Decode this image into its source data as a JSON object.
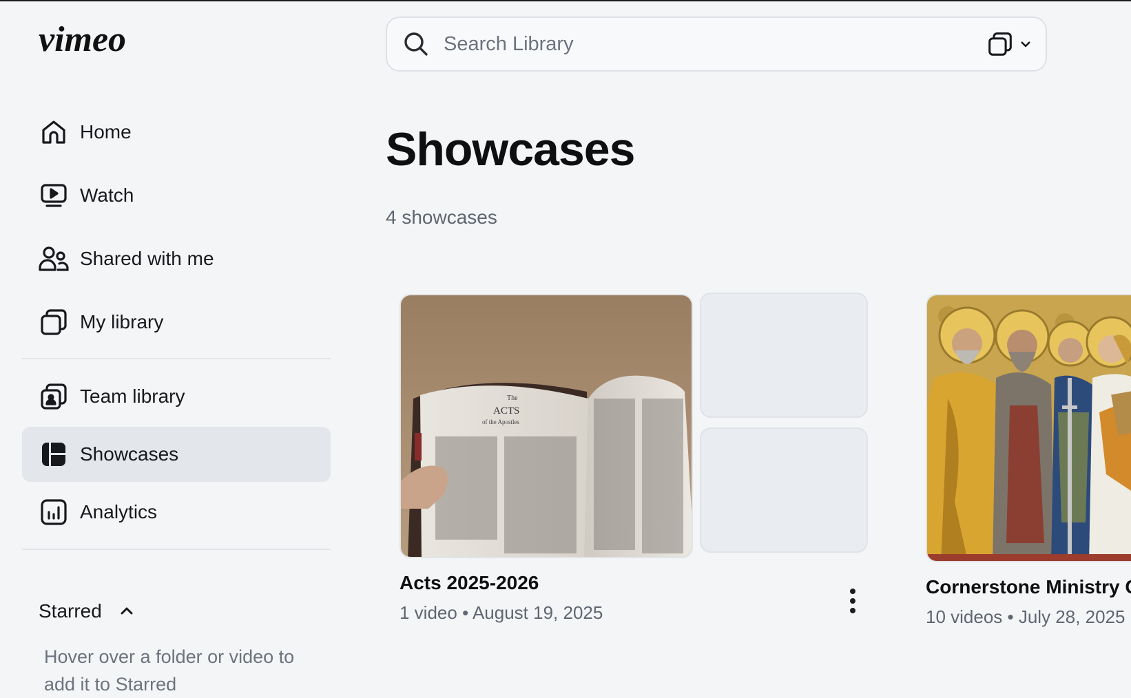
{
  "app": {
    "logo_text": "vimeo"
  },
  "sidebar": {
    "items": [
      {
        "label": "Home",
        "icon": "home-icon"
      },
      {
        "label": "Watch",
        "icon": "play-screen-icon"
      },
      {
        "label": "Shared with me",
        "icon": "users-icon"
      },
      {
        "label": "My library",
        "icon": "library-icon"
      },
      {
        "label": "Team library",
        "icon": "team-library-icon"
      },
      {
        "label": "Showcases",
        "icon": "showcases-icon",
        "active": true
      },
      {
        "label": "Analytics",
        "icon": "analytics-icon"
      }
    ],
    "starred": {
      "label": "Starred",
      "hint": "Hover over a folder or video to add it to Starred"
    }
  },
  "search": {
    "placeholder": "Search Library"
  },
  "main": {
    "title": "Showcases",
    "count": "4 showcases",
    "showcases": [
      {
        "title": "Acts 2025-2026",
        "meta": "1 video • August 19, 2025"
      },
      {
        "title": "Cornerstone Ministry C",
        "meta": "10 videos • July 28, 2025"
      }
    ]
  },
  "colors": {
    "background": "#f4f5f7",
    "active_nav": "#e3e6eb",
    "text_primary": "#0d0f11",
    "text_secondary": "#5f6670"
  }
}
